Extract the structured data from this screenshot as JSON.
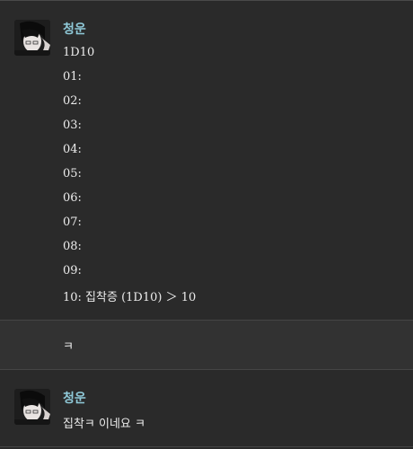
{
  "messages": [
    {
      "author": "청운",
      "avatar_icon": "user-avatar-icon",
      "lines": [
        "1D10",
        "01:",
        "02:",
        "03:",
        "04:",
        "05:",
        "06:",
        "07:",
        "08:",
        "09:",
        "10: 집착증 (1D10) ＞ 10"
      ]
    },
    {
      "lines": [
        "ㅋ"
      ]
    },
    {
      "author": "청운",
      "avatar_icon": "user-avatar-icon",
      "lines": [
        "집착ㅋ 이네요 ㅋ"
      ]
    }
  ],
  "colors": {
    "background": "#2a2a2a",
    "alt_background": "#323232",
    "author_name": "#8fc9d8",
    "text": "#ececec"
  }
}
